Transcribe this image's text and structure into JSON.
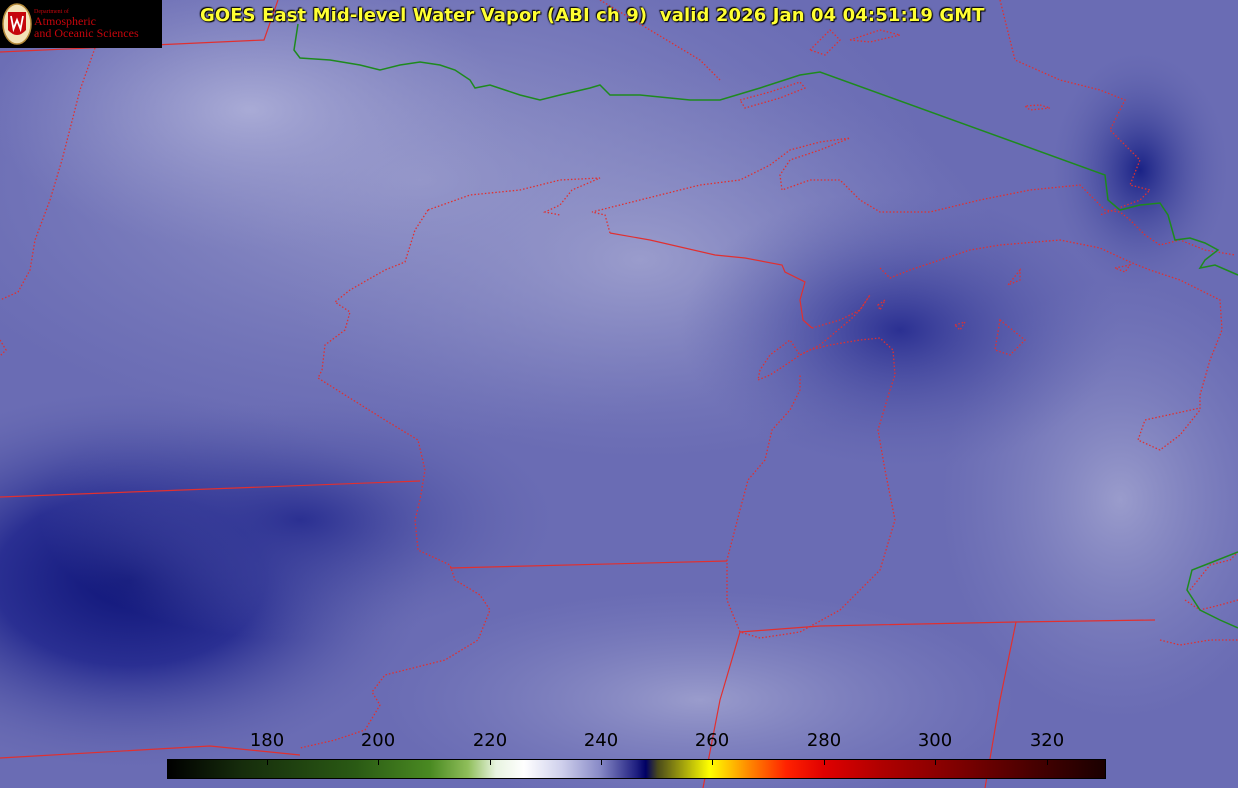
{
  "header": {
    "title": "GOES East Mid-level Water Vapor (ABI ch 9)  valid 2026 Jan 04 04:51:19 GMT"
  },
  "logo": {
    "dept": "Department of",
    "line1": "Atmospheric",
    "line2": "and Oceanic Sciences"
  },
  "colorbar": {
    "ticks": [
      "180",
      "200",
      "220",
      "240",
      "260",
      "280",
      "300",
      "320"
    ]
  },
  "colors": {
    "title": "#ffff33",
    "state_borders": "#e03030",
    "international_border": "#228b22",
    "background_vapor": "#6a6cb4"
  }
}
